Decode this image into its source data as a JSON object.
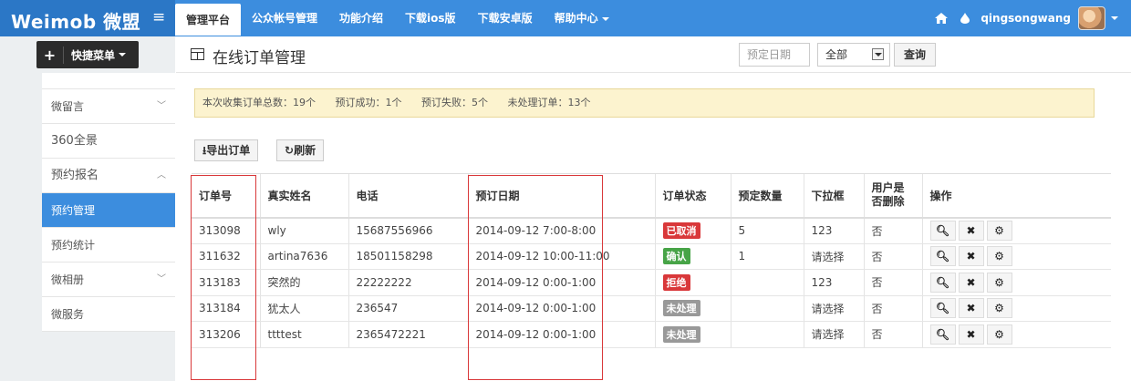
{
  "header": {
    "logo": "Weimob 微盟",
    "nav": [
      {
        "label": "管理平台",
        "active": true
      },
      {
        "label": "公众帐号管理"
      },
      {
        "label": "功能介绍"
      },
      {
        "label": "下载ios版"
      },
      {
        "label": "下载安卓版"
      },
      {
        "label": "帮助中心",
        "dropdown": true
      }
    ],
    "username": "qingsongwang"
  },
  "sidebar": {
    "quick_menu": "快捷菜单",
    "items": [
      {
        "label": "微留言",
        "chevron": "down"
      },
      {
        "label": "360全景"
      },
      {
        "label": "预约报名",
        "chevron": "up"
      },
      {
        "label": "预约管理",
        "active": true
      },
      {
        "label": "预约统计"
      },
      {
        "label": "微相册",
        "chevron": "down"
      },
      {
        "label": "微服务"
      }
    ]
  },
  "page": {
    "title": "在线订单管理",
    "date_placeholder": "预定日期",
    "filter_value": "全部",
    "query_label": "查询"
  },
  "summary": {
    "total": "本次收集订单总数：19个",
    "success": "预订成功：1个",
    "failed": "预订失败：5个",
    "pending": "未处理订单：13个"
  },
  "toolbar": {
    "export_label": "导出订单",
    "refresh_label": "刷新"
  },
  "table": {
    "columns": [
      "订单号",
      "真实姓名",
      "电话",
      "预订日期",
      "订单状态",
      "预定数量",
      "下拉框",
      "用户是否删除",
      "操作"
    ],
    "rows": [
      {
        "order": "313098",
        "name": "wly",
        "phone": "15687556966",
        "date": "2014-09-12 7:00-8:00",
        "status": "已取消",
        "qty": "5",
        "dropdown": "123",
        "deleted": "否"
      },
      {
        "order": "311632",
        "name": "artina7636",
        "phone": "18501158298",
        "date": "2014-09-12 10:00-11:00",
        "status": "确认",
        "qty": "1",
        "dropdown": "请选择",
        "deleted": "否"
      },
      {
        "order": "313183",
        "name": "突然的",
        "phone": "22222222",
        "date": "2014-09-12 0:00-1:00",
        "status": "拒绝",
        "qty": "",
        "dropdown": "123",
        "deleted": "否"
      },
      {
        "order": "313184",
        "name": "犹太人",
        "phone": "236547",
        "date": "2014-09-12 0:00-1:00",
        "status": "未处理",
        "qty": "",
        "dropdown": "请选择",
        "deleted": "否"
      },
      {
        "order": "313206",
        "name": "ttttest",
        "phone": "2365472221",
        "date": "2014-09-12 0:00-1:00",
        "status": "未处理",
        "qty": "",
        "dropdown": "请选择",
        "deleted": "否"
      }
    ]
  },
  "colors": {
    "topbar": "#3c8dde",
    "logo_bg": "#2b77c6",
    "status_cancelled": "#d9383a",
    "status_confirmed": "#47a447",
    "status_rejected": "#d9383a",
    "status_pending": "#999999",
    "highlight_box": "#d9383a"
  }
}
